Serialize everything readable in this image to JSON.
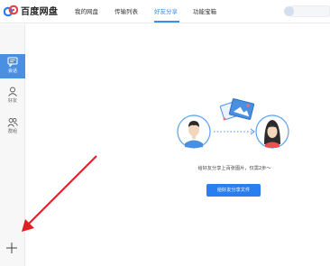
{
  "app": {
    "title": "百度网盘"
  },
  "nav": {
    "items": [
      {
        "label": "我的网盘",
        "active": false
      },
      {
        "label": "传输列表",
        "active": false
      },
      {
        "label": "好友分享",
        "active": true
      },
      {
        "label": "功能宝箱",
        "active": false
      }
    ]
  },
  "sidebar": {
    "items": [
      {
        "label": "会话",
        "icon": "chat-icon",
        "active": true
      },
      {
        "label": "好友",
        "icon": "person-icon",
        "active": false
      },
      {
        "label": "群组",
        "icon": "group-icon",
        "active": false
      }
    ],
    "add_icon": "plus-icon"
  },
  "main": {
    "hint": "给好友分享上百张图片，仅需2步～",
    "share_button": "给好友分享文件"
  },
  "colors": {
    "accent": "#3a8ee6",
    "active_sidebar": "#4a90e2",
    "button": "#2a7ff0",
    "annotation_arrow": "#e02020"
  }
}
